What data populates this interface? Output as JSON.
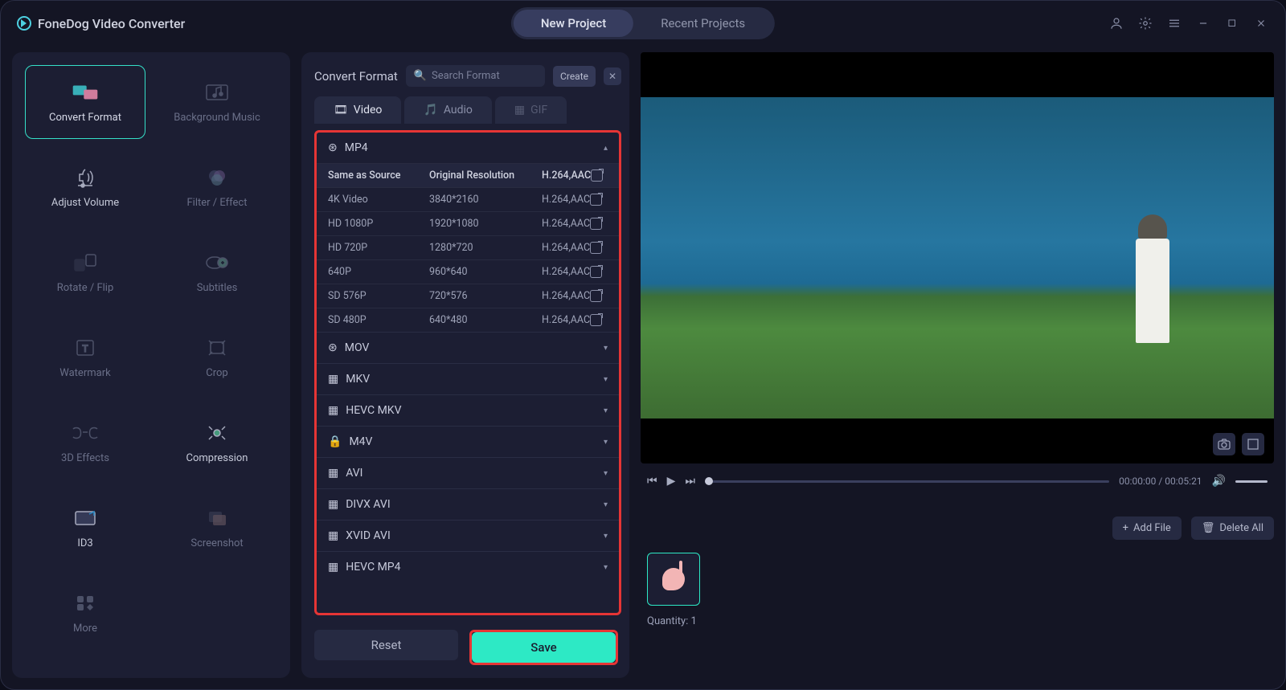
{
  "app_name": "FoneDog Video Converter",
  "top_tabs": {
    "new": "New Project",
    "recent": "Recent Projects"
  },
  "tools": [
    {
      "label": "Convert Format",
      "active": true
    },
    {
      "label": "Background Music"
    },
    {
      "label": "Adjust Volume",
      "bright": true
    },
    {
      "label": "Filter / Effect"
    },
    {
      "label": "Rotate / Flip"
    },
    {
      "label": "Subtitles"
    },
    {
      "label": "Watermark"
    },
    {
      "label": "Crop"
    },
    {
      "label": "3D Effects"
    },
    {
      "label": "Compression",
      "bright": true
    },
    {
      "label": "ID3",
      "bright": true
    },
    {
      "label": "Screenshot"
    },
    {
      "label": "More"
    }
  ],
  "panel": {
    "title": "Convert Format",
    "search_placeholder": "Search Format",
    "create": "Create",
    "type_tabs": {
      "video": "Video",
      "audio": "Audio",
      "gif": "GIF"
    },
    "mp4": {
      "name": "MP4",
      "header": {
        "c1": "Same as Source",
        "c2": "Original Resolution",
        "c3": "H.264,AAC"
      },
      "rows": [
        {
          "c1": "4K Video",
          "c2": "3840*2160",
          "c3": "H.264,AAC"
        },
        {
          "c1": "HD 1080P",
          "c2": "1920*1080",
          "c3": "H.264,AAC"
        },
        {
          "c1": "HD 720P",
          "c2": "1280*720",
          "c3": "H.264,AAC"
        },
        {
          "c1": "640P",
          "c2": "960*640",
          "c3": "H.264,AAC"
        },
        {
          "c1": "SD 576P",
          "c2": "720*576",
          "c3": "H.264,AAC"
        },
        {
          "c1": "SD 480P",
          "c2": "640*480",
          "c3": "H.264,AAC"
        }
      ]
    },
    "groups": [
      "MOV",
      "MKV",
      "HEVC MKV",
      "M4V",
      "AVI",
      "DIVX AVI",
      "XVID AVI",
      "HEVC MP4"
    ],
    "reset": "Reset",
    "save": "Save"
  },
  "player": {
    "time": "00:00:00 / 00:05:21"
  },
  "files": {
    "add": "Add File",
    "delete": "Delete All",
    "quantity": "Quantity: 1"
  }
}
